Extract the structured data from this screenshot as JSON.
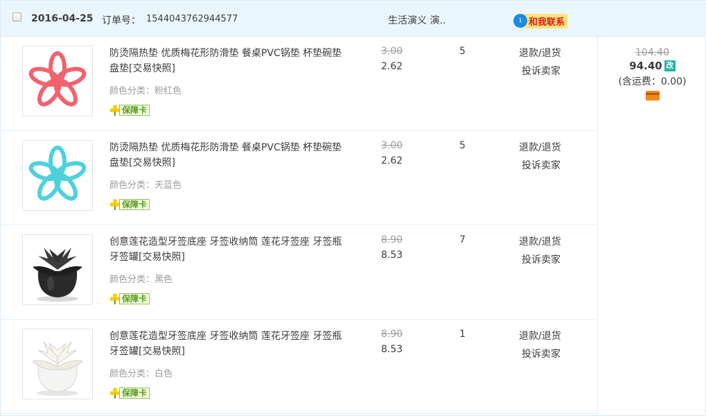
{
  "header": {
    "date": "2016-04-25",
    "order_label": "订单号：",
    "order_number": "1544043762944577",
    "shop_name": "生活演义 演..",
    "contact_label": "和我联系"
  },
  "items": [
    {
      "title": "防烫隔热垫 优质梅花形防滑垫 餐桌PVC锅垫 杯垫碗垫盘垫[交易快照]",
      "spec": "颜色分类：粉红色",
      "badge": "保障卡",
      "original_price": "3.00",
      "price": "2.62",
      "quantity": "5",
      "action_refund": "退款/退货",
      "action_complain": "投诉卖家",
      "image": "pink-flower-mat"
    },
    {
      "title": "防烫隔热垫 优质梅花形防滑垫 餐桌PVC锅垫 杯垫碗垫盘垫[交易快照]",
      "spec": "颜色分类：天蓝色",
      "badge": "保障卡",
      "original_price": "3.00",
      "price": "2.62",
      "quantity": "5",
      "action_refund": "退款/退货",
      "action_complain": "投诉卖家",
      "image": "blue-flower-mat"
    },
    {
      "title": "创意莲花造型牙签底座 牙签收纳筒 莲花牙签座 牙签瓶牙签罐[交易快照]",
      "spec": "颜色分类：黑色",
      "badge": "保障卡",
      "original_price": "8.90",
      "price": "8.53",
      "quantity": "7",
      "action_refund": "退款/退货",
      "action_complain": "投诉卖家",
      "image": "black-lotus-holder"
    },
    {
      "title": "创意莲花造型牙签底座 牙签收纳筒 莲花牙签座 牙签瓶牙签罐[交易快照]",
      "spec": "颜色分类：白色",
      "badge": "保障卡",
      "original_price": "8.90",
      "price": "8.53",
      "quantity": "1",
      "action_refund": "退款/退货",
      "action_complain": "投诉卖家",
      "image": "white-lotus-holder"
    }
  ],
  "summary": {
    "original_total": "104.40",
    "total": "94.40",
    "modified_label": "改",
    "shipping": "(含运费：0.00)"
  },
  "colors": {
    "header_bg": "#eaf6fd",
    "border": "#dbe9f5",
    "contact_bg": "#ffe27a",
    "contact_text": "#d91e18",
    "badge_green": "#5a9f1c",
    "modified_badge": "#25b3a8",
    "pink_item": "#f0636f",
    "blue_item": "#4fd1dc"
  }
}
